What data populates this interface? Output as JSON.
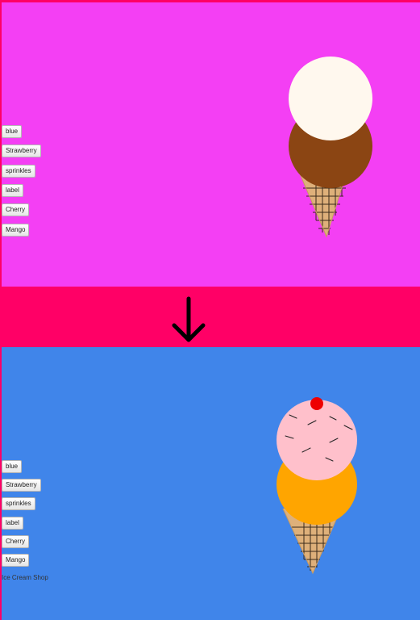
{
  "before": {
    "background_color": "#f43ff4",
    "buttons": [
      {
        "label": "blue"
      },
      {
        "label": "Strawberry"
      },
      {
        "label": "sprinkles"
      },
      {
        "label": "label"
      },
      {
        "label": "Cherry"
      },
      {
        "label": "Mango"
      }
    ],
    "ice_cream": {
      "top_scoop_color": "#fff8ee",
      "bottom_scoop_color": "#8b4513",
      "cone_color": "#deb07a",
      "sprinkles": false,
      "cherry": false
    }
  },
  "transition": {
    "arrow_icon": "arrow-down-icon"
  },
  "after": {
    "background_color": "#4085ea",
    "buttons": [
      {
        "label": "blue"
      },
      {
        "label": "Strawberry"
      },
      {
        "label": "sprinkles"
      },
      {
        "label": "label"
      },
      {
        "label": "Cherry"
      },
      {
        "label": "Mango"
      }
    ],
    "shop_label": "Ice Cream Shop",
    "ice_cream": {
      "top_scoop_color": "#ffc0cb",
      "bottom_scoop_color": "#ffa500",
      "cone_color": "#deb07a",
      "sprinkles": true,
      "cherry": true,
      "cherry_color": "#ee0000"
    }
  }
}
